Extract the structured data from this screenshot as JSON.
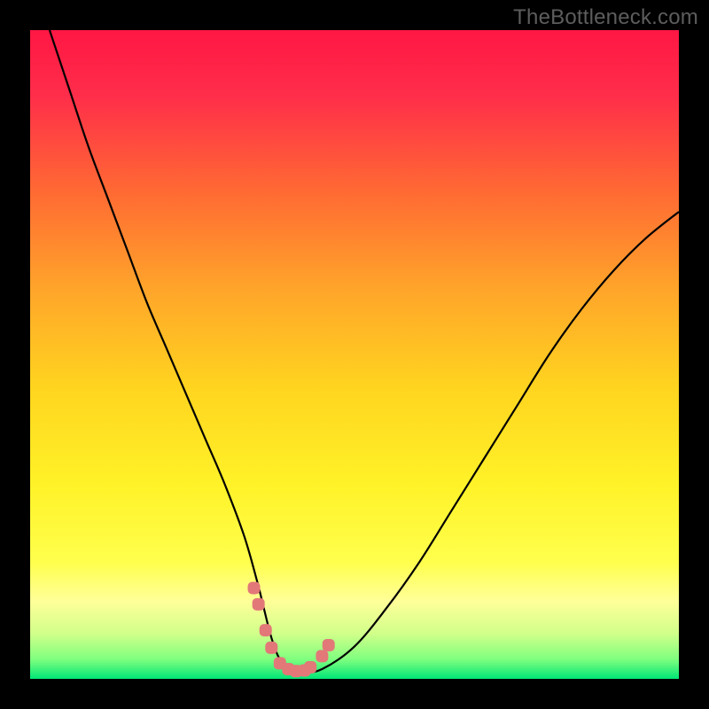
{
  "watermark": "TheBottleneck.com",
  "chart_data": {
    "type": "line",
    "title": "",
    "xlabel": "",
    "ylabel": "",
    "xlim": [
      0,
      100
    ],
    "ylim": [
      0,
      100
    ],
    "grid": false,
    "legend": false,
    "gradient_stops": [
      {
        "pos": 0.0,
        "color": "#ff1744"
      },
      {
        "pos": 0.1,
        "color": "#ff2d4a"
      },
      {
        "pos": 0.25,
        "color": "#ff6a33"
      },
      {
        "pos": 0.4,
        "color": "#ffa52a"
      },
      {
        "pos": 0.55,
        "color": "#ffd41f"
      },
      {
        "pos": 0.7,
        "color": "#fff228"
      },
      {
        "pos": 0.82,
        "color": "#ffff4d"
      },
      {
        "pos": 0.88,
        "color": "#ffff99"
      },
      {
        "pos": 0.93,
        "color": "#d1ff8a"
      },
      {
        "pos": 0.97,
        "color": "#7fff7f"
      },
      {
        "pos": 1.0,
        "color": "#00e676"
      }
    ],
    "series": [
      {
        "name": "bottleneck-curve",
        "color": "#000000",
        "x": [
          3,
          6,
          9,
          12,
          15,
          18,
          21,
          24,
          27,
          30,
          33,
          35,
          36,
          37,
          38,
          39,
          40,
          42,
          45,
          50,
          55,
          60,
          65,
          70,
          75,
          80,
          85,
          90,
          95,
          100
        ],
        "y": [
          100,
          91,
          82,
          74,
          66,
          58,
          51,
          44,
          37,
          30,
          22,
          15,
          11,
          7,
          4,
          2.2,
          1.2,
          1.0,
          1.5,
          5,
          11,
          18,
          26,
          34,
          42,
          50,
          57,
          63,
          68,
          72
        ]
      }
    ],
    "highlight_markers": {
      "name": "ideal-zone-markers",
      "color": "#e27878",
      "x": [
        34.5,
        35.2,
        36.3,
        37.2,
        38.5,
        39.8,
        41.0,
        42.3,
        43.2,
        45.0,
        46.0
      ],
      "y": [
        14.0,
        11.5,
        7.5,
        4.8,
        2.4,
        1.5,
        1.2,
        1.3,
        1.8,
        3.5,
        5.2
      ]
    },
    "green_band": {
      "y_low": 0,
      "y_high": 6
    },
    "pale_yellow_band": {
      "y_low": 6,
      "y_high": 18
    }
  }
}
